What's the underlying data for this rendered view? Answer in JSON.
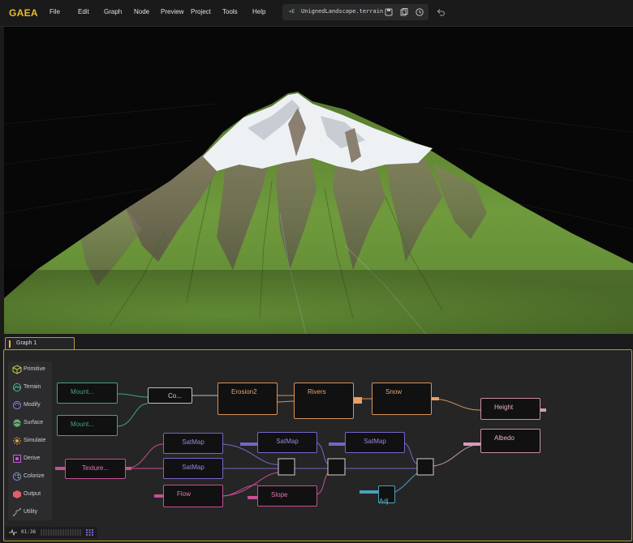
{
  "app": {
    "logo": "GAEA"
  },
  "menu": [
    "File",
    "Edit",
    "Graph",
    "Node",
    "Preview",
    "Project",
    "Tools",
    "Help"
  ],
  "file": {
    "tag": "<E",
    "name": "UnignedLandscape.terrain"
  },
  "graph_tab": {
    "label": "Graph 1"
  },
  "palette": [
    {
      "label": "Primitive",
      "icon": "cube-icon",
      "color": "#c9c94a"
    },
    {
      "label": "Terrain",
      "icon": "terrain-icon",
      "color": "#4fb38c"
    },
    {
      "label": "Modify",
      "icon": "modify-icon",
      "color": "#8a7bd8"
    },
    {
      "label": "Surface",
      "icon": "surface-icon",
      "color": "#6ec47a"
    },
    {
      "label": "Simulate",
      "icon": "simulate-icon",
      "color": "#e0a050"
    },
    {
      "label": "Derive",
      "icon": "derive-icon",
      "color": "#c95bd6"
    },
    {
      "label": "Colorize",
      "icon": "palette-icon",
      "color": "#7a8ee0"
    },
    {
      "label": "Output",
      "icon": "output-icon",
      "color": "#e0606a"
    },
    {
      "label": "Utility",
      "icon": "utility-icon",
      "color": "#a0a0a0"
    }
  ],
  "nodes": [
    {
      "id": "mount1",
      "title": "Mount...",
      "color": "#3fa77b"
    },
    {
      "id": "mount2",
      "title": "Mount...",
      "color": "#3fa77b"
    },
    {
      "id": "combine",
      "title": "Co...",
      "color": "#bfbfbf"
    },
    {
      "id": "erosion2",
      "title": "Erosion2",
      "color": "#d99357"
    },
    {
      "id": "rivers",
      "title": "Rivers",
      "color": "#d99357"
    },
    {
      "id": "snow",
      "title": "Snow",
      "color": "#d99357"
    },
    {
      "id": "height",
      "title": "Height",
      "color": "#c98ea8"
    },
    {
      "id": "texture",
      "title": "Texture...",
      "color": "#c94f97"
    },
    {
      "id": "satmap1",
      "title": "SatMap",
      "color": "#7a64c8"
    },
    {
      "id": "satmap2",
      "title": "SatMap",
      "color": "#7a64c8"
    },
    {
      "id": "flow",
      "title": "Flow",
      "color": "#c94f97"
    },
    {
      "id": "satmap3",
      "title": "SatMap",
      "color": "#7a64c8"
    },
    {
      "id": "slope",
      "title": "Slope",
      "color": "#c94f97"
    },
    {
      "id": "satmap4",
      "title": "SatMap",
      "color": "#7a64c8"
    },
    {
      "id": "albedo",
      "title": "Albedo",
      "color": "#c98ea8"
    },
    {
      "id": "adj",
      "title": "Adj...",
      "color": "#4aa0b8"
    }
  ],
  "status": {
    "time": "01:36"
  }
}
